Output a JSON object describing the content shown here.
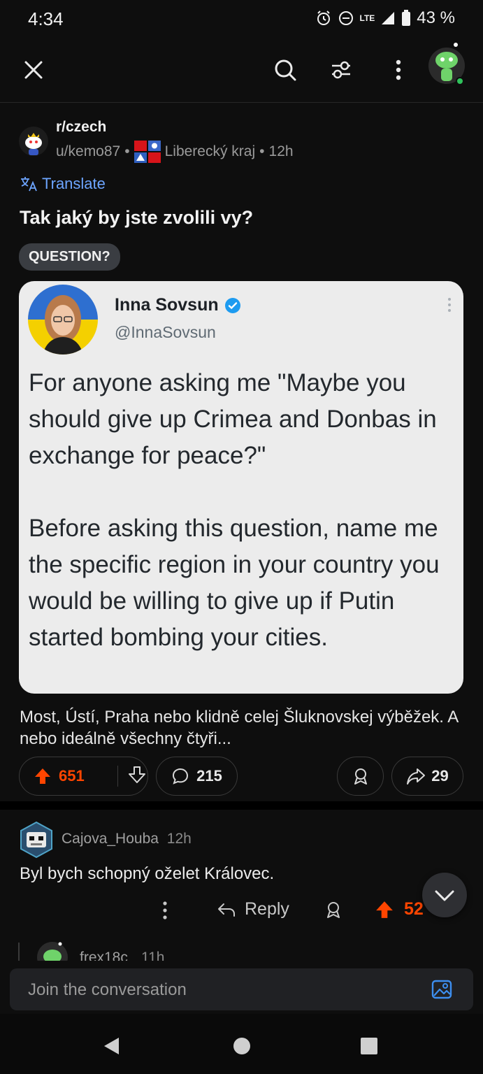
{
  "status_bar": {
    "time": "4:34",
    "network": "LTE",
    "battery": "43 %"
  },
  "post": {
    "subreddit": "r/czech",
    "user": "u/kemo87",
    "user_flair": "Liberecký kraj",
    "age": "12h",
    "translate_label": "Translate",
    "title": "Tak jaký by jste zvolili vy?",
    "flair": "QUESTION?",
    "tweet": {
      "name": "Inna Sovsun",
      "handle": "@InnaSovsun",
      "text": "For anyone asking me \"Maybe you should give up Crimea and Donbas in exchange for peace?\"\n\nBefore asking this question, name me the specific region in your country you would be willing to give up if Putin started bombing your cities."
    },
    "body": "Most, Ústí, Praha nebo klidně celej Šluknovskej výběžek. A nebo ideálně všechny čtyři...",
    "upvotes": "651",
    "comments": "215",
    "shares": "29"
  },
  "comment": {
    "username": "Cajova_Houba",
    "age": "12h",
    "text": "Byl bych schopný oželet Královec.",
    "reply_label": "Reply",
    "score": "52"
  },
  "next_comment_peek": {
    "username": "frex18c",
    "age": "11h"
  },
  "composer": {
    "placeholder": "Join the conversation"
  },
  "colors": {
    "accent_orange": "#ff4500",
    "link_blue": "#6da5ff",
    "verified_blue": "#1d9bf0"
  }
}
